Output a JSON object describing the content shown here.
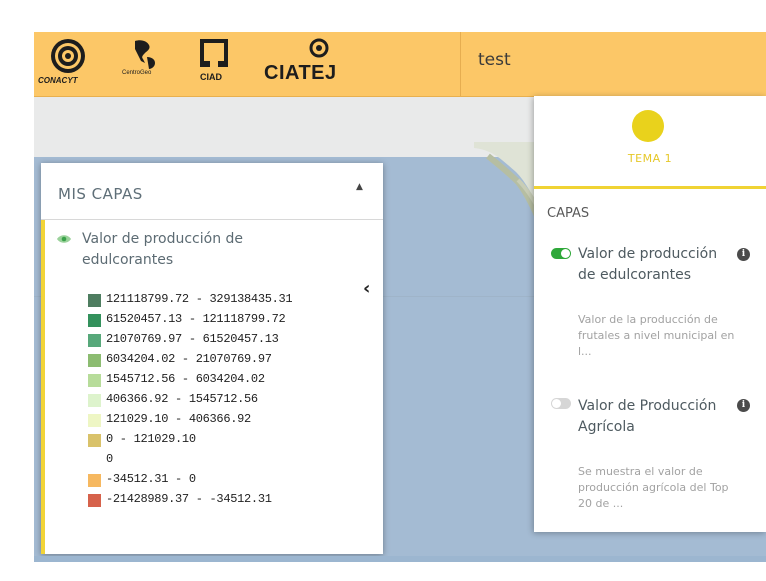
{
  "header": {
    "title": "test",
    "logos": [
      {
        "name": "CONACYT",
        "icon": "conacyt-seal-icon"
      },
      {
        "name": "CentroGeo",
        "icon": "centrogeo-americas-icon"
      },
      {
        "name": "CIAD",
        "icon": "ciad-frame-icon"
      },
      {
        "name": "CIATEJ",
        "icon": "ciatej-eye-icon"
      }
    ],
    "background": "#fcc767"
  },
  "layers_panel": {
    "title": "MIS CAPAS",
    "collapse_icon": "caret-up-icon",
    "back_icon": "chevron-left-icon",
    "layer": {
      "name": "Valor de producción de edulcorantes",
      "visibility_icon": "eye-icon"
    },
    "legend": [
      {
        "range": "121118799.72 - 329138435.31",
        "color": "#4e7d60"
      },
      {
        "range": "61520457.13 - 121118799.72",
        "color": "#33915c"
      },
      {
        "range": "21070769.97 - 61520457.13",
        "color": "#57a87a"
      },
      {
        "range": "6034204.02 - 21070769.97",
        "color": "#8cbc71"
      },
      {
        "range": "1545712.56 - 6034204.02",
        "color": "#b7dc9a"
      },
      {
        "range": "406366.92 - 1545712.56",
        "color": "#ddf3cc"
      },
      {
        "range": "121029.10 - 406366.92",
        "color": "#eef6c4"
      },
      {
        "range": "0 - 121029.10",
        "color": "#d9c26a"
      },
      {
        "range": "0",
        "color": ""
      },
      {
        "range": "-34512.31 - 0",
        "color": "#f6b860"
      },
      {
        "range": "-21428989.37 - -34512.31",
        "color": "#d6624b"
      }
    ]
  },
  "theme_panel": {
    "theme_label": "TEMA 1",
    "theme_color": "#e9d21c",
    "section_label": "CAPAS",
    "items": [
      {
        "name": "Valor de producción de edulcorantes",
        "description": "Valor de la producción de frutales a nivel municipal en l...",
        "enabled": true,
        "info_icon": "info-icon"
      },
      {
        "name": "Valor de Producción Agrícola",
        "description": "Se muestra el valor de producción agrícola del Top 20 de ...",
        "enabled": false,
        "info_icon": "info-icon"
      }
    ]
  }
}
